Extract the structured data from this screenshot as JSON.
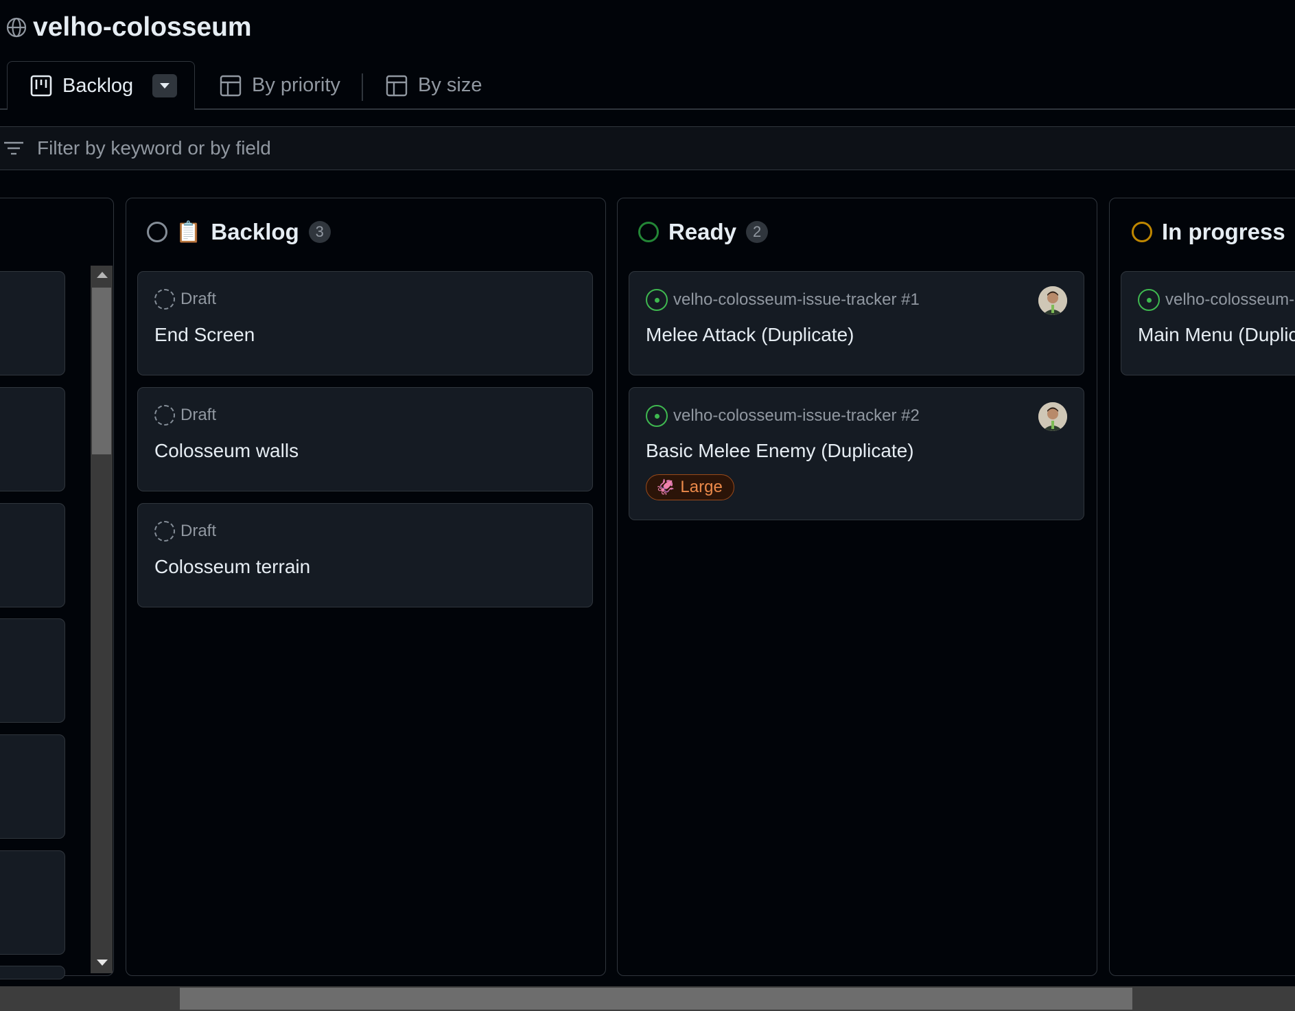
{
  "project": {
    "title": "velho-colosseum",
    "visibility_icon": "globe-icon"
  },
  "views": [
    {
      "label": "Backlog",
      "icon": "board-icon",
      "active": true
    },
    {
      "label": "By priority",
      "icon": "table-icon",
      "active": false
    },
    {
      "label": "By size",
      "icon": "table-icon",
      "active": false
    }
  ],
  "filter": {
    "placeholder": "Filter by keyword or by field",
    "value": ""
  },
  "columns": {
    "backlog": {
      "name": "Backlog",
      "emoji": "📋",
      "count": "3",
      "status_color": "#848d97",
      "cards": [
        {
          "type": "Draft",
          "title": "End Screen"
        },
        {
          "type": "Draft",
          "title": "Colosseum walls"
        },
        {
          "type": "Draft",
          "title": "Colosseum terrain"
        }
      ]
    },
    "ready": {
      "name": "Ready",
      "count": "2",
      "status_color": "#238636",
      "cards": [
        {
          "ref": "velho-colosseum-issue-tracker #1",
          "title": "Melee Attack (Duplicate)",
          "has_avatar": true
        },
        {
          "ref": "velho-colosseum-issue-tracker #2",
          "title": "Basic Melee Enemy (Duplicate)",
          "has_avatar": true,
          "label": {
            "text": "Large",
            "emoji": "🦑",
            "color": "#ec8a4a"
          }
        }
      ]
    },
    "in_progress": {
      "name": "In progress",
      "status_color": "#bf8700",
      "cards": [
        {
          "ref": "velho-colosseum-",
          "title": "Main Menu (Duplic"
        }
      ]
    }
  },
  "colors": {
    "background": "#010409",
    "card": "#151b23",
    "border": "#30363d",
    "open_issue": "#3fb950"
  }
}
